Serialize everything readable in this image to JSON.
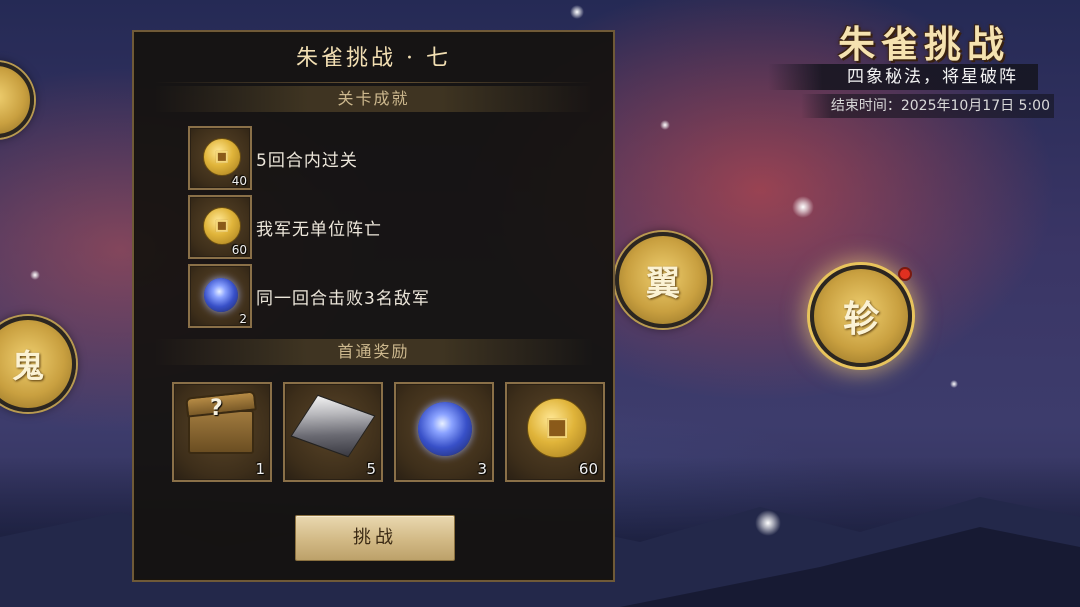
{
  "event": {
    "title": "朱雀挑战",
    "subtitle": "四象秘法，将星破阵",
    "end_time": "结束时间：2025年10月17日 5:00"
  },
  "stage_nodes": {
    "left_bottom": "鬼",
    "wing": "翼",
    "active": "轸"
  },
  "panel": {
    "title": "朱雀挑战 · 七",
    "achievements_header": "关卡成就",
    "achievements": [
      {
        "icon": "gold-coin-icon",
        "count": "40",
        "label": "5回合内过关"
      },
      {
        "icon": "gold-coin-icon",
        "count": "60",
        "label": "我军无单位阵亡"
      },
      {
        "icon": "blue-orb-icon",
        "count": "2",
        "label": "同一回合击败3名敌军"
      }
    ],
    "first_clear_header": "首通奖励",
    "rewards": [
      {
        "icon": "mystery-chest-icon",
        "count": "1",
        "glyph": "?"
      },
      {
        "icon": "silver-ingot-icon",
        "count": "5"
      },
      {
        "icon": "blue-orb-icon",
        "count": "3"
      },
      {
        "icon": "gold-coin-icon",
        "count": "60"
      }
    ],
    "challenge_button": "挑战"
  }
}
